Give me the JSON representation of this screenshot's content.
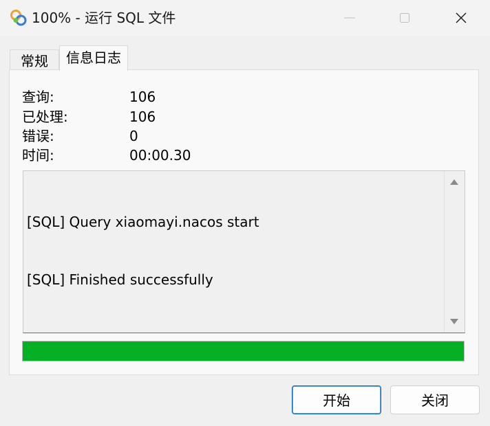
{
  "window": {
    "title": "100% - 运行 SQL 文件",
    "icon": "navicat-app-icon",
    "controls": {
      "minimize": "minimize-icon",
      "maximize": "maximize-icon",
      "close": "close-icon"
    }
  },
  "tabs": [
    {
      "label": "常规",
      "selected": false
    },
    {
      "label": "信息日志",
      "selected": true
    }
  ],
  "info": {
    "query_label": "查询:",
    "query_value": "106",
    "processed_label": "已处理:",
    "processed_value": "106",
    "errors_label": "错误:",
    "errors_value": "0",
    "time_label": "时间:",
    "time_value": "00:00.30"
  },
  "log": {
    "lines": [
      "[SQL] Query xiaomayi.nacos start",
      "[SQL] Finished successfully"
    ]
  },
  "progress": {
    "fraction": 1.0,
    "color": "#06b025"
  },
  "buttons": {
    "start": "开始",
    "close": "关闭"
  }
}
